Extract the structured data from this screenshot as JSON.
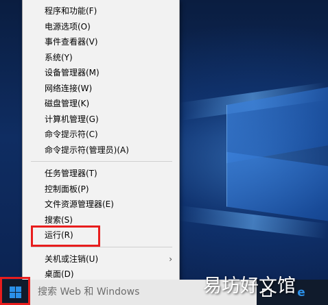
{
  "context_menu": {
    "groups": [
      [
        {
          "label": "程序和功能(F)"
        },
        {
          "label": "电源选项(O)"
        },
        {
          "label": "事件查看器(V)"
        },
        {
          "label": "系统(Y)"
        },
        {
          "label": "设备管理器(M)"
        },
        {
          "label": "网络连接(W)"
        },
        {
          "label": "磁盘管理(K)"
        },
        {
          "label": "计算机管理(G)"
        },
        {
          "label": "命令提示符(C)"
        },
        {
          "label": "命令提示符(管理员)(A)"
        }
      ],
      [
        {
          "label": "任务管理器(T)"
        },
        {
          "label": "控制面板(P)"
        },
        {
          "label": "文件资源管理器(E)"
        },
        {
          "label": "搜索(S)"
        },
        {
          "label": "运行(R)"
        }
      ],
      [
        {
          "label": "关机或注销(U)",
          "submenu": true
        },
        {
          "label": "桌面(D)"
        }
      ]
    ],
    "submenu_arrow": "›"
  },
  "taskbar": {
    "search_placeholder": "搜索 Web 和 Windows"
  },
  "watermark": {
    "text": "易坊好文馆"
  },
  "colors": {
    "menu_bg": "#f2f2f2",
    "highlight": "#e81d1d",
    "taskbar_bg": "#101b2c",
    "start_logo": "#2b90e8"
  },
  "icons": {
    "start": "windows-logo-icon",
    "task_view": "task-view-icon",
    "browser": "edge-icon"
  }
}
